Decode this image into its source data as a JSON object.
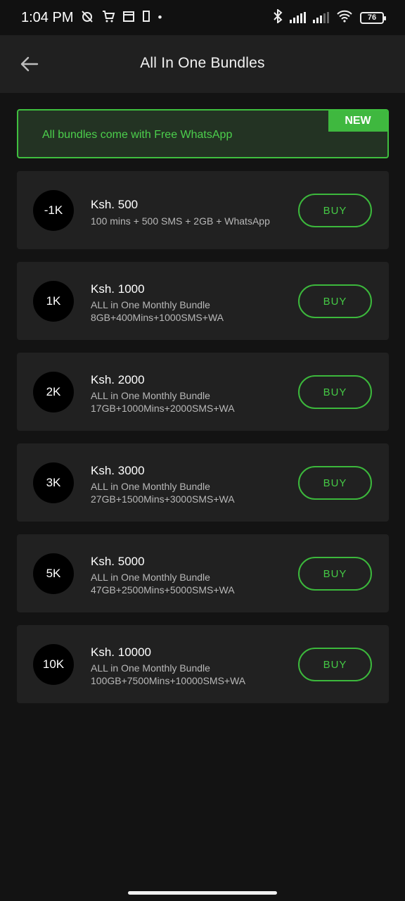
{
  "status_bar": {
    "time": "1:04 PM",
    "battery": "76"
  },
  "app_bar": {
    "title": "All In One Bundles"
  },
  "banner": {
    "text": "All bundles come with Free WhatsApp",
    "badge": "NEW"
  },
  "bundles": [
    {
      "badge": "-1K",
      "price": "Ksh. 500",
      "line1": "100 mins + 500 SMS + 2GB + WhatsApp",
      "line2": "",
      "button": "BUY"
    },
    {
      "badge": "1K",
      "price": "Ksh. 1000",
      "line1": "ALL in One Monthly Bundle",
      "line2": "8GB+400Mins+1000SMS+WA",
      "button": "BUY"
    },
    {
      "badge": "2K",
      "price": "Ksh. 2000",
      "line1": "ALL in One Monthly Bundle",
      "line2": "17GB+1000Mins+2000SMS+WA",
      "button": "BUY"
    },
    {
      "badge": "3K",
      "price": "Ksh. 3000",
      "line1": "ALL in One Monthly Bundle",
      "line2": "27GB+1500Mins+3000SMS+WA",
      "button": "BUY"
    },
    {
      "badge": "5K",
      "price": "Ksh. 5000",
      "line1": "ALL in One Monthly Bundle",
      "line2": "47GB+2500Mins+5000SMS+WA",
      "button": "BUY"
    },
    {
      "badge": "10K",
      "price": "Ksh. 10000",
      "line1": "ALL in One Monthly Bundle",
      "line2": "100GB+7500Mins+10000SMS+WA",
      "button": "BUY"
    }
  ],
  "colors": {
    "accent": "#3fb83f",
    "background": "#131313",
    "card": "#212121"
  }
}
